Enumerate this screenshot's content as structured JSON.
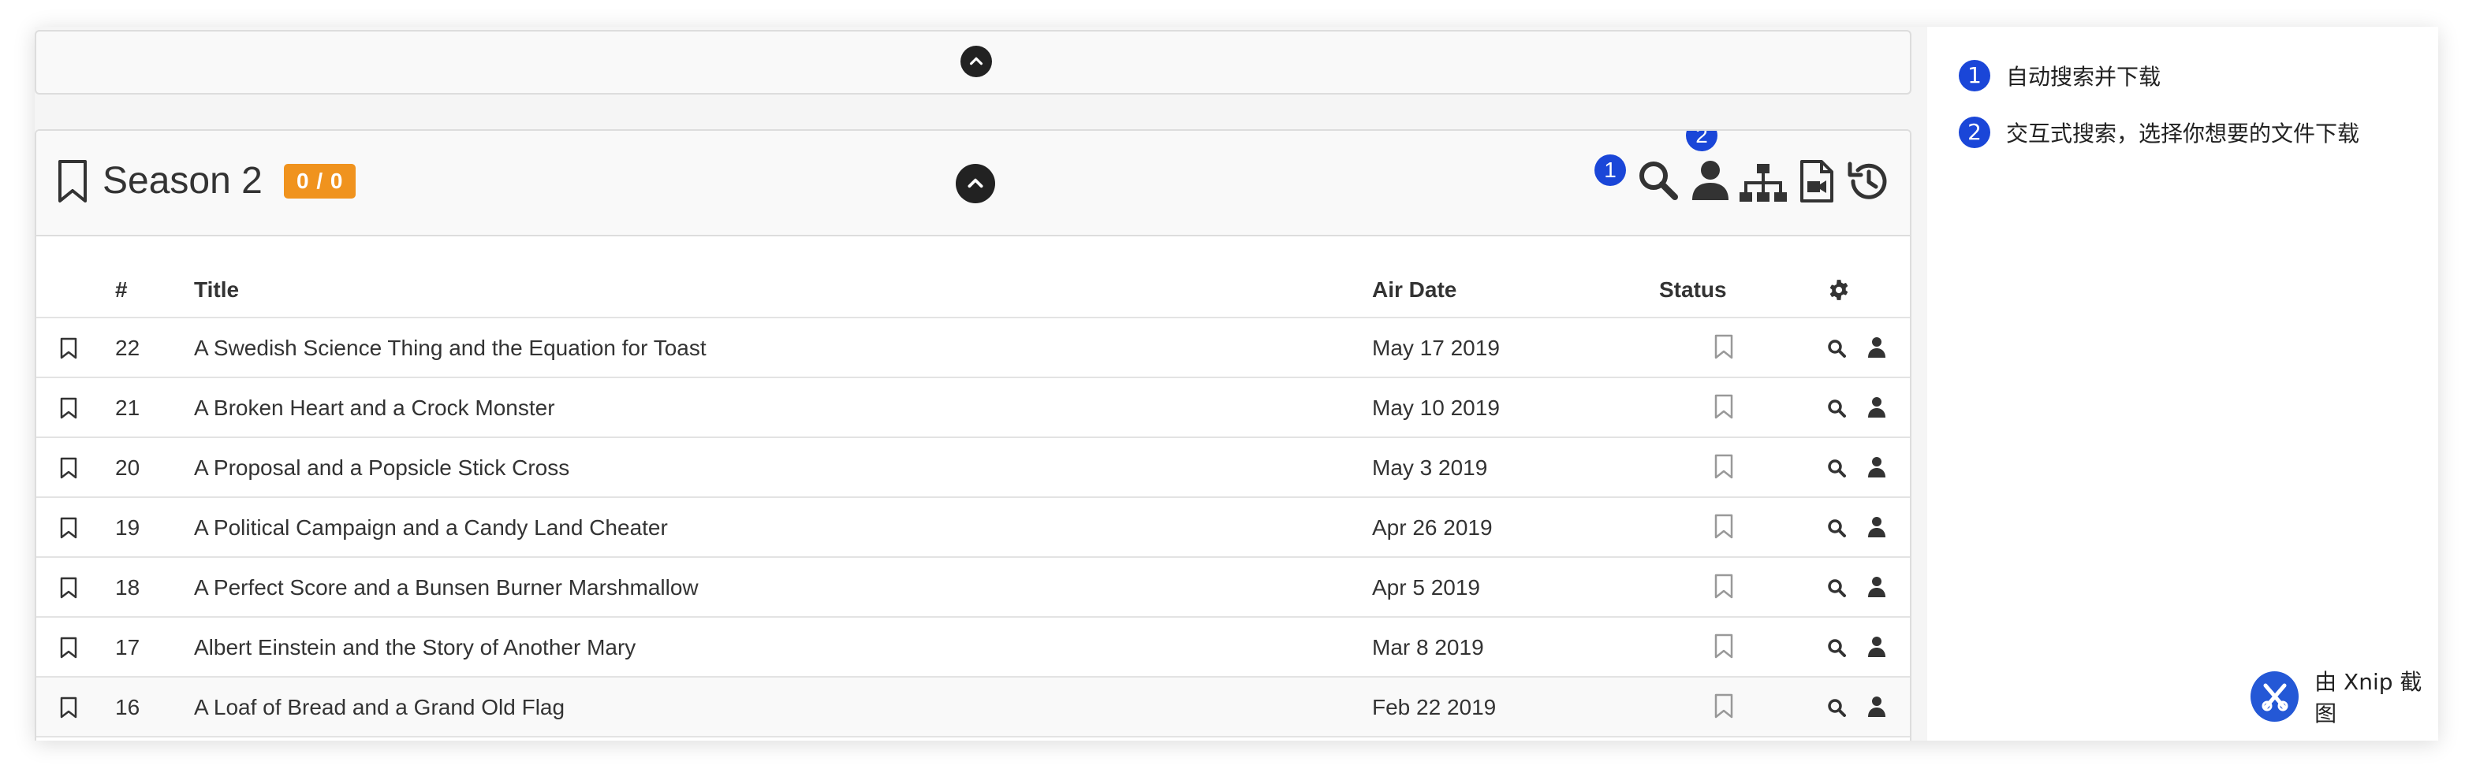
{
  "season": {
    "title": "Season 2",
    "badge": "0 / 0"
  },
  "icons": {
    "header_actions": [
      "search-icon",
      "user-icon",
      "sitemap-icon",
      "file-video-icon",
      "history-icon"
    ],
    "row_actions": [
      "search-icon",
      "user-icon"
    ],
    "collapse": "chevron-up-icon"
  },
  "callouts": {
    "one": "1",
    "two": "2"
  },
  "table": {
    "headers": {
      "num": "#",
      "title": "Title",
      "air_date": "Air Date",
      "status": "Status",
      "actions_icon": "gear-icon"
    },
    "rows": [
      {
        "num": "22",
        "title": "A Swedish Science Thing and the Equation for Toast",
        "air_date": "May 17 2019"
      },
      {
        "num": "21",
        "title": "A Broken Heart and a Crock Monster",
        "air_date": "May 10 2019"
      },
      {
        "num": "20",
        "title": "A Proposal and a Popsicle Stick Cross",
        "air_date": "May 3 2019"
      },
      {
        "num": "19",
        "title": "A Political Campaign and a Candy Land Cheater",
        "air_date": "Apr 26 2019"
      },
      {
        "num": "18",
        "title": "A Perfect Score and a Bunsen Burner Marshmallow",
        "air_date": "Apr 5 2019"
      },
      {
        "num": "17",
        "title": "Albert Einstein and the Story of Another Mary",
        "air_date": "Mar 8 2019"
      },
      {
        "num": "16",
        "title": "A Loaf of Bread and a Grand Old Flag",
        "air_date": "Feb 22 2019"
      }
    ]
  },
  "notes": [
    {
      "num": "1",
      "text": "自动搜索并下载"
    },
    {
      "num": "2",
      "text": "交互式搜索，选择你想要的文件下载"
    }
  ],
  "watermark": {
    "text": "由 Xnip 截图"
  },
  "colors": {
    "badge_orange": "#f0931e",
    "callout_blue": "#1a46d8",
    "icon_dark": "#333333",
    "icon_muted": "#999999"
  }
}
